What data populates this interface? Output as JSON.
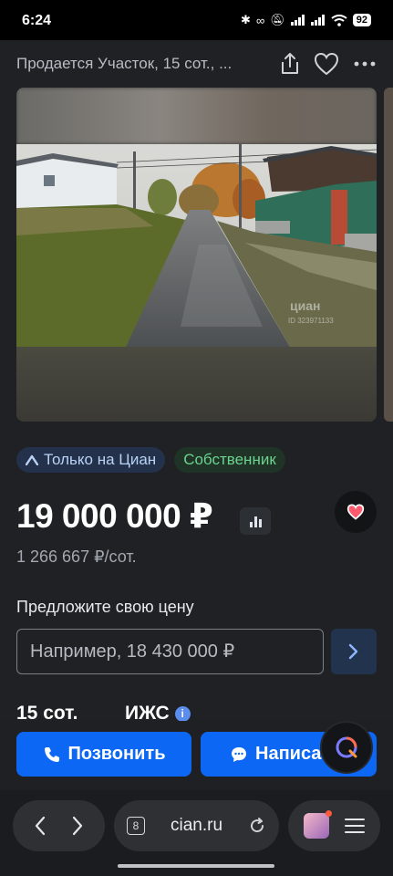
{
  "status_bar": {
    "time": "6:24",
    "battery": "92"
  },
  "header": {
    "title": "Продается Участок, 15 сот., ..."
  },
  "badges": {
    "cian_only": "Только на Циан",
    "owner": "Собственник"
  },
  "price": {
    "total": "19 000 000 ₽",
    "per_unit": "1 266 667 ₽/сот."
  },
  "offer": {
    "label": "Предложите свою цену",
    "placeholder": "Например, 18 430 000 ₽"
  },
  "facts": {
    "area": "15 сот.",
    "type": "ИЖС"
  },
  "actions": {
    "call": "Позвонить",
    "message": "Написать"
  },
  "browser": {
    "tab_count": "8",
    "url": "cian.ru"
  },
  "colors": {
    "accent": "#0c68f4",
    "owner_badge_text": "#6cd38f",
    "heart": "#ff5a6e"
  }
}
